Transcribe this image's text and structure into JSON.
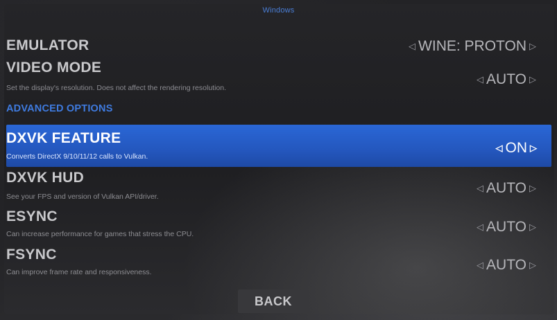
{
  "window": {
    "title": "Windows"
  },
  "settings": [
    {
      "name": "EMULATOR",
      "description": "",
      "value": "WINE: PROTON"
    },
    {
      "name": "VIDEO MODE",
      "description": "Set the display's resolution. Does not affect the rendering resolution.",
      "value": "AUTO"
    }
  ],
  "advanced": {
    "section_label": "ADVANCED OPTIONS",
    "selected_index": 0,
    "items": [
      {
        "name": "DXVK FEATURE",
        "description": "Converts DirectX 9/10/11/12 calls to Vulkan.",
        "value": "ON"
      },
      {
        "name": "DXVK HUD",
        "description": "See your FPS and version of Vulkan API/driver.",
        "value": "AUTO"
      },
      {
        "name": "ESYNC",
        "description": "Can increase performance for games that stress the CPU.",
        "value": "AUTO"
      },
      {
        "name": "FSYNC",
        "description": "Can improve frame rate and responsiveness.",
        "value": "AUTO"
      }
    ]
  },
  "footer": {
    "back_label": "BACK"
  },
  "colors": {
    "accent": "#2a67d6",
    "section_label": "#3f7be0",
    "title": "#4a7ed6"
  },
  "icons": {
    "decrease": "left-arrow-icon",
    "increase": "right-arrow-icon"
  }
}
